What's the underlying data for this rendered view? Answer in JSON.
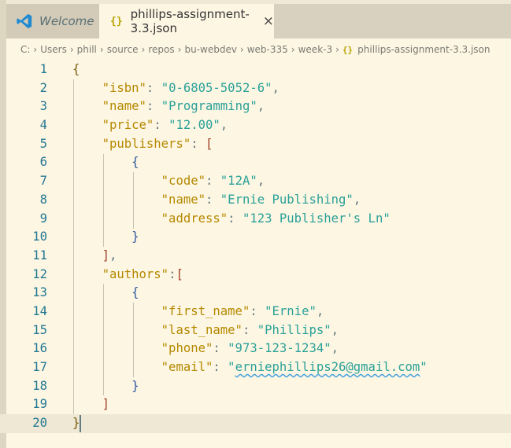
{
  "tabs": [
    {
      "label": "Welcome",
      "icon": "vscode-icon",
      "active": false
    },
    {
      "label": "phillips-assignment-3.3.json",
      "icon": "json-icon",
      "active": true,
      "close": "×"
    }
  ],
  "breadcrumb": {
    "items": [
      "C:",
      "Users",
      "phill",
      "source",
      "repos",
      "bu-webdev",
      "web-335",
      "week-3"
    ],
    "file": "phillips-assignment-3.3.json",
    "separator": "›",
    "json_glyph": "{}"
  },
  "colors": {
    "background": "#fdf6e3",
    "key": "#b58900",
    "string": "#2aa198",
    "line_number": "#237893"
  },
  "editor": {
    "current_line": 20,
    "lines": [
      {
        "n": "1",
        "t": [
          [
            "b1",
            "{"
          ]
        ]
      },
      {
        "n": "2",
        "t": [
          [
            "p",
            "    "
          ],
          [
            "k",
            "\"isbn\""
          ],
          [
            "p",
            ": "
          ],
          [
            "s",
            "\"0-6805-5052-6\""
          ],
          [
            "p",
            ","
          ]
        ]
      },
      {
        "n": "3",
        "t": [
          [
            "p",
            "    "
          ],
          [
            "k",
            "\"name\""
          ],
          [
            "p",
            ": "
          ],
          [
            "s",
            "\"Programming\""
          ],
          [
            "p",
            ","
          ]
        ]
      },
      {
        "n": "4",
        "t": [
          [
            "p",
            "    "
          ],
          [
            "k",
            "\"price\""
          ],
          [
            "p",
            ": "
          ],
          [
            "s",
            "\"12.00\""
          ],
          [
            "p",
            ","
          ]
        ]
      },
      {
        "n": "5",
        "t": [
          [
            "p",
            "    "
          ],
          [
            "k",
            "\"publishers\""
          ],
          [
            "p",
            ": "
          ],
          [
            "b2",
            "["
          ]
        ]
      },
      {
        "n": "6",
        "t": [
          [
            "p",
            "        "
          ],
          [
            "b3",
            "{"
          ]
        ]
      },
      {
        "n": "7",
        "t": [
          [
            "p",
            "            "
          ],
          [
            "k",
            "\"code\""
          ],
          [
            "p",
            ": "
          ],
          [
            "s",
            "\"12A\""
          ],
          [
            "p",
            ","
          ]
        ]
      },
      {
        "n": "8",
        "t": [
          [
            "p",
            "            "
          ],
          [
            "k",
            "\"name\""
          ],
          [
            "p",
            ": "
          ],
          [
            "s",
            "\"Ernie Publishing\""
          ],
          [
            "p",
            ","
          ]
        ]
      },
      {
        "n": "9",
        "t": [
          [
            "p",
            "            "
          ],
          [
            "k",
            "\"address\""
          ],
          [
            "p",
            ": "
          ],
          [
            "s",
            "\"123 Publisher's Ln\""
          ]
        ]
      },
      {
        "n": "10",
        "t": [
          [
            "p",
            "        "
          ],
          [
            "b3",
            "}"
          ]
        ]
      },
      {
        "n": "11",
        "t": [
          [
            "p",
            "    "
          ],
          [
            "b2",
            "]"
          ],
          [
            "p",
            ","
          ]
        ]
      },
      {
        "n": "12",
        "t": [
          [
            "p",
            "    "
          ],
          [
            "k",
            "\"authors\""
          ],
          [
            "p",
            ":"
          ],
          [
            "b2",
            "["
          ]
        ]
      },
      {
        "n": "13",
        "t": [
          [
            "p",
            "        "
          ],
          [
            "b3",
            "{"
          ]
        ]
      },
      {
        "n": "14",
        "t": [
          [
            "p",
            "            "
          ],
          [
            "k",
            "\"first_name\""
          ],
          [
            "p",
            ": "
          ],
          [
            "s",
            "\"Ernie\""
          ],
          [
            "p",
            ","
          ]
        ]
      },
      {
        "n": "15",
        "t": [
          [
            "p",
            "            "
          ],
          [
            "k",
            "\"last_name\""
          ],
          [
            "p",
            ": "
          ],
          [
            "s",
            "\"Phillips\""
          ],
          [
            "p",
            ","
          ]
        ]
      },
      {
        "n": "16",
        "t": [
          [
            "p",
            "            "
          ],
          [
            "k",
            "\"phone\""
          ],
          [
            "p",
            ": "
          ],
          [
            "s",
            "\"973-123-1234\""
          ],
          [
            "p",
            ","
          ]
        ]
      },
      {
        "n": "17",
        "t": [
          [
            "p",
            "            "
          ],
          [
            "k",
            "\"email\""
          ],
          [
            "p",
            ": "
          ],
          [
            "s",
            "\""
          ],
          [
            "s squiggle",
            "erniephillips26@gmail.com"
          ],
          [
            "s",
            "\""
          ]
        ]
      },
      {
        "n": "18",
        "t": [
          [
            "p",
            "        "
          ],
          [
            "b3",
            "}"
          ]
        ]
      },
      {
        "n": "19",
        "t": [
          [
            "p",
            "    "
          ],
          [
            "b2",
            "]"
          ]
        ]
      },
      {
        "n": "20",
        "t": [
          [
            "b1",
            "}"
          ]
        ]
      }
    ]
  }
}
